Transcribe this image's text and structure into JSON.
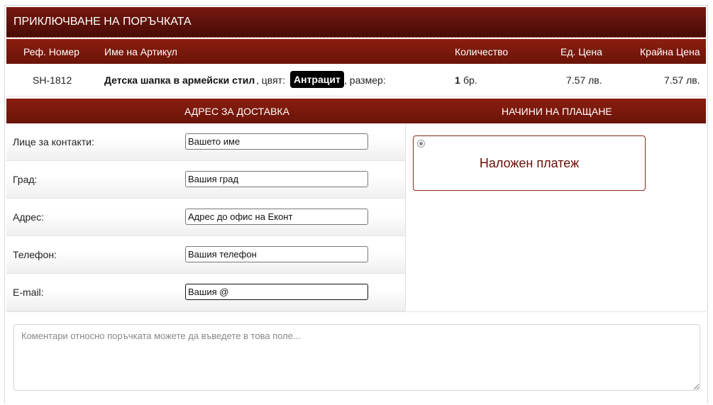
{
  "header": {
    "title": "ПРИКЛЮЧВАНЕ НА ПОРЪЧКАТА"
  },
  "table": {
    "columns": [
      "Реф. Номер",
      "Име на Артикул",
      "Количество",
      "Ед. Цена",
      "Крайна Цена"
    ],
    "row": {
      "ref": "SH-1812",
      "name": "Детска шапка в армейски стил",
      "color_label": ", цвят:",
      "color_value": "Антрацит",
      "size_label": ", размер:",
      "qty_value": "1",
      "qty_unit": "бр.",
      "unit_price": "7.57 лв.",
      "total_price": "7.57 лв."
    }
  },
  "sections": {
    "delivery": "АДРЕС ЗА ДОСТАВКА",
    "payment": "НАЧИНИ НА ПЛАЩАНЕ"
  },
  "form": {
    "fields": [
      {
        "label": "Лице за контакти:",
        "value": "Вашето име"
      },
      {
        "label": "Град:",
        "value": "Вашия град"
      },
      {
        "label": "Адрес:",
        "value": "Адрес до офис на Еконт"
      },
      {
        "label": "Телефон:",
        "value": "Вашия телефон"
      },
      {
        "label": "E-mail:",
        "value": "Вашия @"
      }
    ]
  },
  "payment": {
    "option": "Наложен платеж"
  },
  "comments": {
    "placeholder": "Коментари относно поръчката можете да въведете в това поле..."
  },
  "colors": {
    "accent": "#7a1a11",
    "payment_text": "#6a0f08"
  }
}
